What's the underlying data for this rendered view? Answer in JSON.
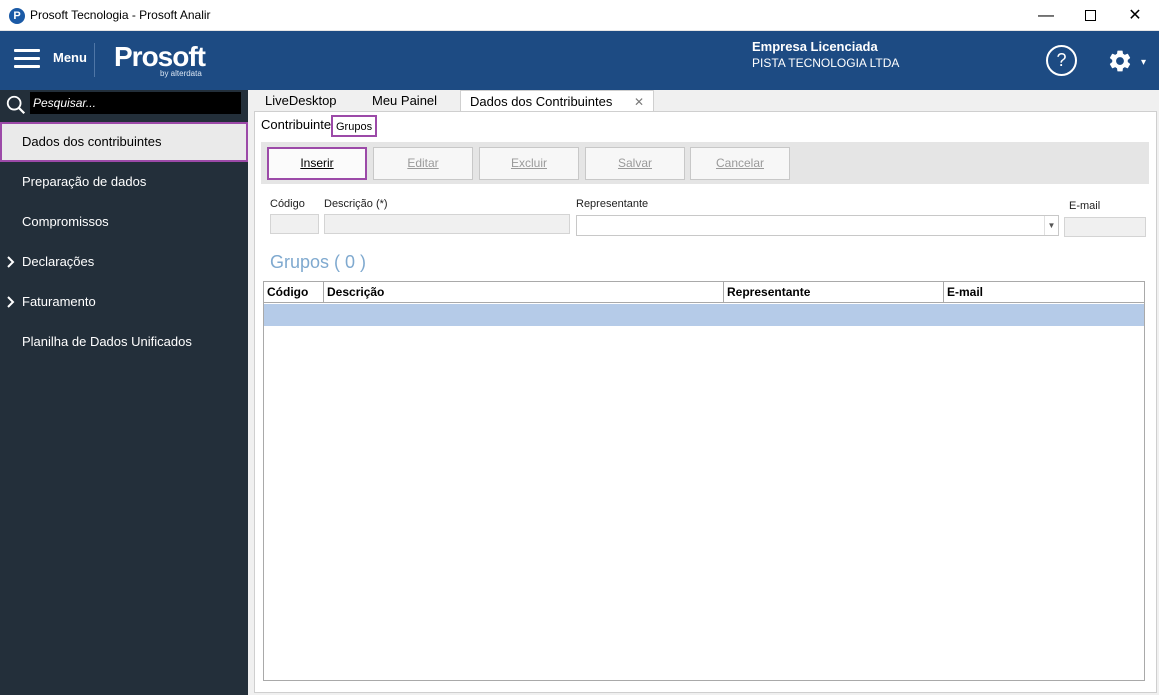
{
  "window": {
    "title": "Prosoft Tecnologia - Prosoft Analir",
    "app_icon": "P",
    "minimize": "—",
    "close": "✕"
  },
  "header": {
    "menu_label": "Menu",
    "logo": "Prosoft",
    "logo_sub": "by alterdata",
    "company_title": "Empresa Licenciada",
    "company_name": "PISTA TECNOLOGIA LTDA",
    "help": "?",
    "settings_icon": "gear-icon",
    "settings_caret": "▾"
  },
  "sidebar": {
    "search_placeholder": "Pesquisar...",
    "items": [
      {
        "label": "Dados dos contribuintes",
        "active": true,
        "expandable": false
      },
      {
        "label": "Preparação de dados",
        "active": false,
        "expandable": false
      },
      {
        "label": "Compromissos",
        "active": false,
        "expandable": false
      },
      {
        "label": "Declarações",
        "active": false,
        "expandable": true
      },
      {
        "label": "Faturamento",
        "active": false,
        "expandable": true
      },
      {
        "label": "Planilha de Dados Unificados",
        "active": false,
        "expandable": false
      }
    ]
  },
  "tabs": [
    {
      "label": "LiveDesktop",
      "active": false
    },
    {
      "label": "Meu Painel",
      "active": false
    },
    {
      "label": "Dados dos Contribuintes",
      "active": true
    }
  ],
  "tab_close": "✕",
  "subtabs": {
    "contribuinte": "Contribuinte",
    "grupos": "Grupos"
  },
  "toolbar": {
    "inserir": "Inserir",
    "editar": "Editar",
    "excluir": "Excluir",
    "salvar": "Salvar",
    "cancelar": "Cancelar"
  },
  "form": {
    "codigo_label": "Código",
    "descricao_label": "Descrição (*)",
    "representante_label": "Representante",
    "email_label": "E-mail",
    "codigo_value": "",
    "descricao_value": "",
    "representante_value": "",
    "email_value": ""
  },
  "groups_title": "Grupos ( 0 )",
  "grid": {
    "columns": [
      "Código",
      "Descrição",
      "Representante",
      "E-mail"
    ],
    "rows": []
  },
  "colors": {
    "header_bg": "#1d4b83",
    "sidebar_bg": "#232f3a",
    "highlight": "#9c4aa8",
    "selected_row": "#b5cbe8"
  }
}
